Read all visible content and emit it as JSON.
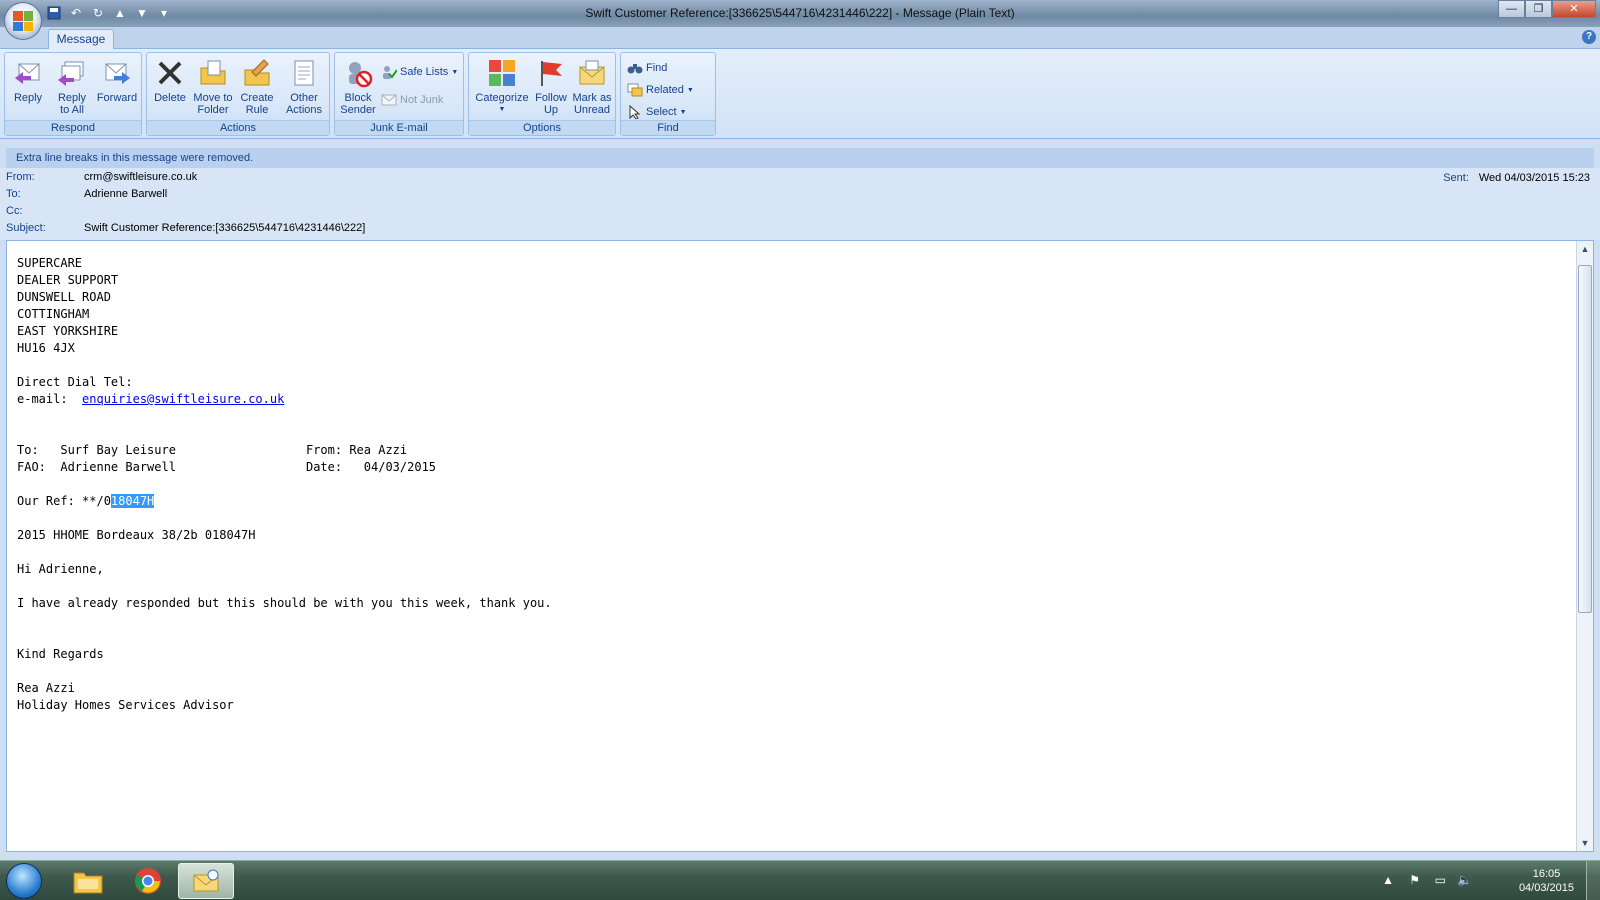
{
  "window": {
    "title": "Swift Customer Reference:[336625\\544716\\4231446\\222] - Message (Plain Text)",
    "minimize_glyph": "—",
    "restore_glyph": "❐",
    "close_glyph": "✕"
  },
  "ribbon": {
    "tab": "Message",
    "help_glyph": "?",
    "groups": {
      "respond": "Respond",
      "actions": "Actions",
      "junk": "Junk E-mail",
      "options": "Options",
      "find": "Find"
    },
    "buttons": {
      "reply": "Reply",
      "reply_all": "Reply to All",
      "forward": "Forward",
      "delete": "Delete",
      "move_to_folder": "Move to Folder",
      "create_rule": "Create Rule",
      "other_actions": "Other Actions",
      "block_sender": "Block Sender",
      "safe_lists": "Safe Lists",
      "not_junk": "Not Junk",
      "categorize": "Categorize",
      "follow_up": "Follow Up",
      "mark_unread": "Mark as Unread",
      "find": "Find",
      "related": "Related",
      "select": "Select"
    }
  },
  "infobar": "Extra line breaks in this message were removed.",
  "header": {
    "from_label": "From:",
    "from": "crm@swiftleisure.co.uk",
    "to_label": "To:",
    "to": "Adrienne Barwell",
    "cc_label": "Cc:",
    "cc": "",
    "subject_label": "Subject:",
    "subject": "Swift Customer Reference:[336625\\544716\\4231446\\222]",
    "sent_label": "Sent:",
    "sent": "Wed 04/03/2015 15:23"
  },
  "body": {
    "address": "SUPERCARE\nDEALER SUPPORT\nDUNSWELL ROAD\nCOTTINGHAM\nEAST YORKSHIRE\nHU16 4JX\n\nDirect Dial Tel:",
    "email_label": "e-mail:  ",
    "email_link": "enquiries@swiftleisure.co.uk",
    "to_block": "\n\n\nTo:   Surf Bay Leisure                  From: Rea Azzi\nFAO:  Adrienne Barwell                  Date:   04/03/2015\n\n",
    "ref_prefix": "Our Ref: **/0",
    "ref_selected": "18047H",
    "rest": "\n\n2015 HHOME Bordeaux 38/2b 018047H\n\nHi Adrienne,\n\nI have already responded but this should be with you this week, thank you.\n\n\nKind Regards\n\nRea Azzi\nHoliday Homes Services Advisor"
  },
  "taskbar": {
    "time": "16:05",
    "date": "04/03/2015"
  },
  "colors": {
    "ribbon_text": "#15428b",
    "link": "#0000ee",
    "selection": "#3399ff"
  }
}
